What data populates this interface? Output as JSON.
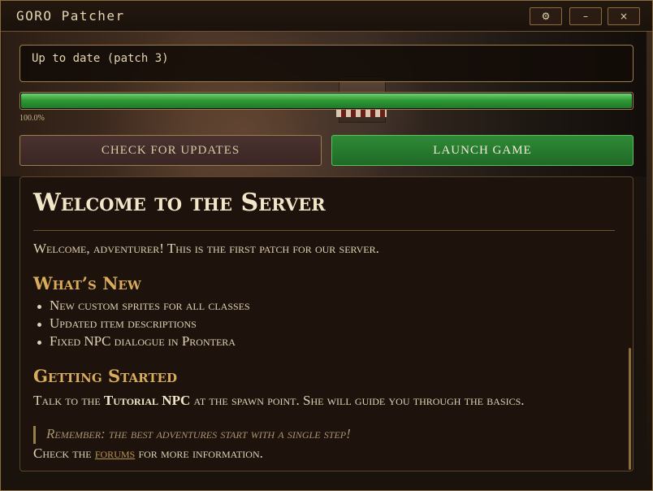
{
  "window": {
    "title": "GORO Patcher",
    "settings_icon": "⚙",
    "minimize_icon": "–",
    "close_icon": "×"
  },
  "status": {
    "text": "Up to date (patch 3)"
  },
  "progress": {
    "percent": 100,
    "label": "100.0%"
  },
  "buttons": {
    "check_updates": "CHECK FOR UPDATES",
    "launch_game": "LAUNCH GAME"
  },
  "news": {
    "title": "Welcome to the Server",
    "intro": "Welcome, adventurer! This is the first patch for our server.",
    "whats_new_heading": "What’s New",
    "whats_new_items": [
      "New custom sprites for all classes",
      "Updated item descriptions",
      "Fixed NPC dialogue in Prontera"
    ],
    "getting_started_heading": "Getting Started",
    "getting_started_prefix": "Talk to the",
    "getting_started_bold": "Tutorial NPC",
    "getting_started_suffix": "at the spawn point. She will guide you through the basics.",
    "quote": "Remember: the best adventures start with a single step!",
    "footer_prefix": "Check the",
    "footer_link": "forums",
    "footer_suffix": "for more information."
  },
  "colors": {
    "accent_gold": "#9c7e4a",
    "launch_green": "#2f8a36",
    "heading_gold": "#d9ac5c"
  }
}
